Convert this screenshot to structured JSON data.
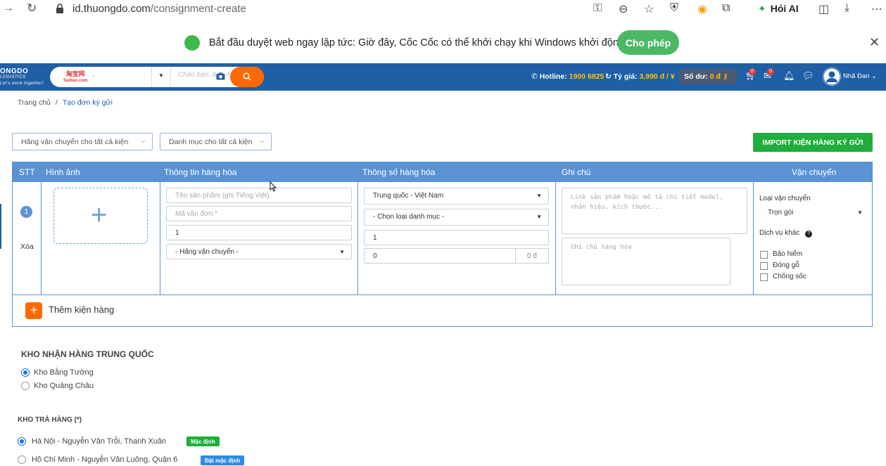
{
  "browser": {
    "url_host": "id.thuongdo.com",
    "url_path": "/consignment-create",
    "hoi_ai_label": "Hỏi AI",
    "icons": [
      "back-icon",
      "reload-icon",
      "lock-icon",
      "key-icon",
      "zoom-out-icon",
      "star-icon",
      "shield-icon",
      "coccoc-icon",
      "extension-icon",
      "split-view-icon",
      "download-icon",
      "more-icon"
    ]
  },
  "notification": {
    "text": "Bắt đầu duyệt web ngay lập tức: Giờ đây, Cốc Cốc có thể khởi chạy khi Windows khởi động.",
    "allow_label": "Cho phép",
    "close_label": "✕"
  },
  "site_header": {
    "logo_text": "ONGDO",
    "logo_sub": "LOGISTICS",
    "logo_tagline": "Let's work together!",
    "taobao_label": "淘宝网",
    "taobao_sub": "Taobao.com",
    "search_placeholder": "Chào bạn, bạn muốn tìm",
    "hotline_label": "Hotline:",
    "hotline_value": "1900 6825",
    "rate_label": "Tỷ giá:",
    "rate_value": "3,990 đ / ¥",
    "balance_label": "Số dư:",
    "balance_value": "0 đ",
    "cart_badge": "0",
    "mail_badge": "0",
    "user_name": "Nhã Đan"
  },
  "breadcrumb": {
    "home": "Trang chủ",
    "separator": "/",
    "current": "Tạo đơn ký gửi"
  },
  "filters": {
    "carrier_all": "Hãng vận chuyển cho tất cả kiện",
    "category_all": "Danh mục cho tất cả kiện",
    "import_label": "IMPORT KIỆN HÀNG KÝ GỬI"
  },
  "table": {
    "headers": {
      "stt": "STT",
      "image": "Hình ảnh",
      "product_info": "Thông tin hàng hóa",
      "product_specs": "Thông số hàng hóa",
      "notes": "Ghi chú",
      "shipping": "Vận chuyển"
    },
    "row": {
      "number": "1",
      "delete_label": "Xóa",
      "product_name_placeholder": "Tên sản phẩm (ghi Tiếng Việt)",
      "tracking_placeholder": "Mã vận đơn *",
      "quantity_value": "1",
      "carrier_select": "- Hãng vận chuyển -",
      "route_select": "Trung quốc - Việt Nam",
      "category_select": "- Chọn loại danh mục -",
      "spec_quantity": "1",
      "price_value": "0",
      "price_suffix": "0 đ",
      "link_placeholder": "Link sản phẩm hoặc mô tả chi tiết model, nhãn hiệu, kích thước...",
      "note_placeholder": "Ghi chú hàng hóa",
      "shipping_type_label": "Loại vận chuyển",
      "shipping_type_value": "Trọn gói",
      "extra_services_label": "Dịch vụ khác",
      "help_label": "?",
      "services": [
        "Bảo hiểm",
        "Đóng gỗ",
        "Chống sốc"
      ]
    },
    "add_package_label": "Thêm kiện hàng"
  },
  "china_warehouse": {
    "title": "KHO NHẬN HÀNG TRUNG QUỐC",
    "options": [
      "Kho Bằng Tường",
      "Kho Quảng Châu"
    ],
    "selected_index": 0
  },
  "return_warehouse": {
    "title": "KHO TRẢ HÀNG (*)",
    "options": [
      "Hà Nội - Nguyễn Văn Trỗi, Thanh Xuân",
      "Hồ Chí Minh - Nguyễn Văn Luông, Quận 6"
    ],
    "default_tag": "Mặc định",
    "set_default_tag": "Đặt mặc định",
    "selected_index": 0
  },
  "colors": {
    "header_blue": "#1f5fa6",
    "table_blue": "#5b92d4",
    "green": "#1fae3c",
    "orange": "#ff6a00"
  }
}
